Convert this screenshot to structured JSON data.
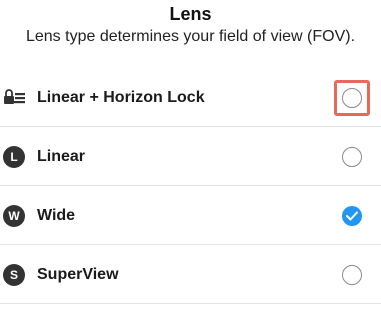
{
  "header": {
    "title": "Lens",
    "subtitle": "Lens type determines your field of view (FOV)."
  },
  "options": [
    {
      "label": "Linear + Horizon Lock",
      "icon": "horizon-lock-icon",
      "letter": "",
      "selected": false,
      "highlighted": true
    },
    {
      "label": "Linear",
      "icon": "linear-lens-icon",
      "letter": "L",
      "selected": false,
      "highlighted": false
    },
    {
      "label": "Wide",
      "icon": "wide-lens-icon",
      "letter": "W",
      "selected": true,
      "highlighted": false
    },
    {
      "label": "SuperView",
      "icon": "superview-lens-icon",
      "letter": "S",
      "selected": false,
      "highlighted": false
    }
  ],
  "colors": {
    "accent": "#2196f3",
    "highlight": "#e8685a",
    "divider": "#e2e2e2"
  }
}
